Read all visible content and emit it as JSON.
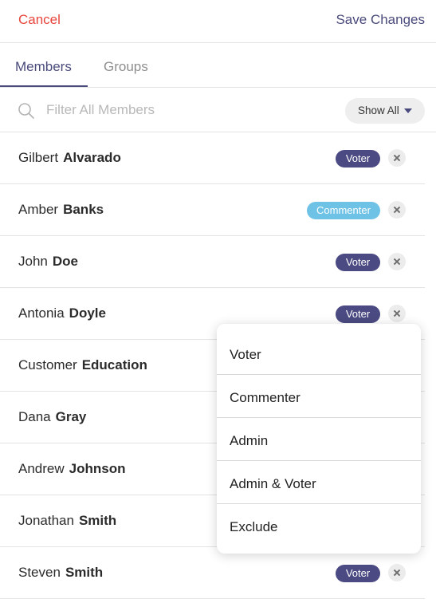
{
  "header": {
    "cancel_label": "Cancel",
    "save_label": "Save Changes"
  },
  "tabs": [
    {
      "label": "Members",
      "active": true
    },
    {
      "label": "Groups",
      "active": false
    }
  ],
  "filter": {
    "placeholder": "Filter All Members",
    "value": "",
    "show_all_label": "Show All"
  },
  "members": [
    {
      "first": "Gilbert",
      "last": "Alvarado",
      "role": "Voter"
    },
    {
      "first": "Amber",
      "last": "Banks",
      "role": "Commenter"
    },
    {
      "first": "John",
      "last": "Doe",
      "role": "Voter"
    },
    {
      "first": "Antonia",
      "last": "Doyle",
      "role": "Voter"
    },
    {
      "first": "Customer",
      "last": "Education",
      "role": ""
    },
    {
      "first": "Dana",
      "last": "Gray",
      "role": ""
    },
    {
      "first": "Andrew",
      "last": "Johnson",
      "role": ""
    },
    {
      "first": "Jonathan",
      "last": "Smith",
      "role": ""
    },
    {
      "first": "Steven",
      "last": "Smith",
      "role": "Voter"
    }
  ],
  "role_menu": {
    "options": [
      "Voter",
      "Commenter",
      "Admin",
      "Admin & Voter",
      "Exclude"
    ]
  },
  "colors": {
    "accent": "#4a4a7c",
    "cancel": "#e8453c",
    "voter_badge": "#4b4a82",
    "commenter_badge": "#6ec2e6"
  },
  "icons": {
    "search": "search-icon",
    "remove": "close-icon",
    "dropdown": "caret-down-icon"
  }
}
